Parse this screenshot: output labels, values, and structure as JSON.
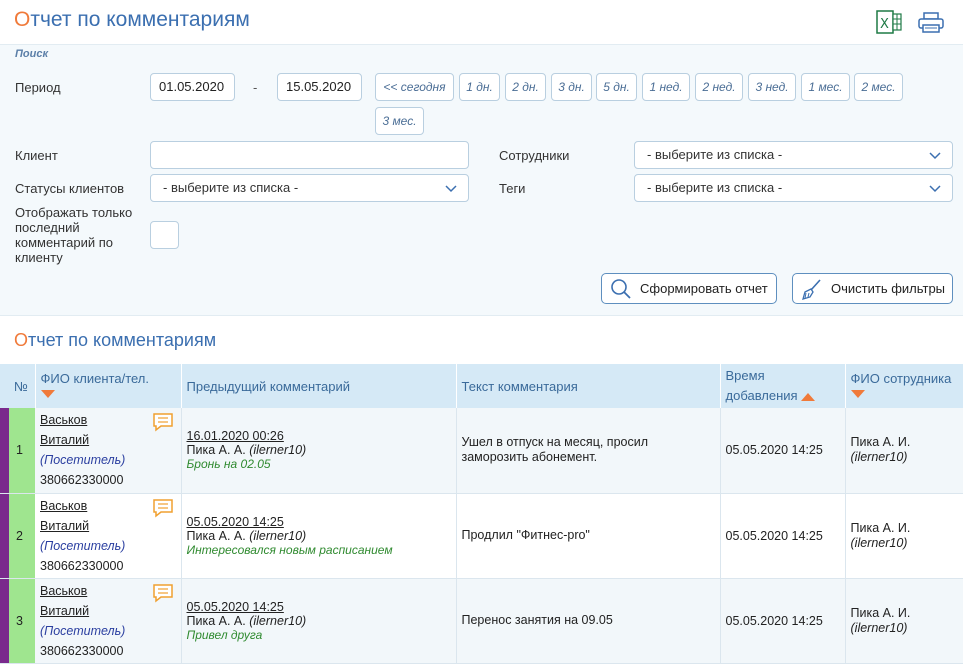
{
  "header": {
    "title_first_letter": "О",
    "title_rest": "тчет по комментариям",
    "excel_icon": "excel-icon",
    "print_icon": "printer-icon"
  },
  "filters": {
    "search_label": "Поиск",
    "period_label": "Период",
    "date_from": "01.05.2020",
    "date_separator": "-",
    "date_to": "15.05.2020",
    "quick_periods": [
      "<< сегодня",
      "1 дн.",
      "2 дн.",
      "3 дн.",
      "5 дн.",
      "1 нед.",
      "2 нед.",
      "3 нед.",
      "1 мес.",
      "2 мес.",
      "3 мес."
    ],
    "client_label": "Клиент",
    "client_value": "",
    "employees_label": "Сотрудники",
    "employees_value": "- выберите из списка -",
    "client_statuses_label": "Статусы клиентов",
    "client_statuses_value": "- выберите из списка -",
    "tags_label": "Теги",
    "tags_value": "- выберите из списка -",
    "last_comment_only_label_lines": [
      "Отображать только",
      "последний",
      "комментарий по",
      "клиенту"
    ],
    "last_comment_only_checked": false,
    "generate_button": "Сформировать отчет",
    "clear_button": "Очистить фильтры"
  },
  "report": {
    "title_first_letter": "О",
    "title_rest": "тчет по комментариям",
    "columns": {
      "num": "№",
      "client": "ФИО клиента/тел.",
      "prev_comment": "Предыдущий комментарий",
      "comment_text": "Текст комментария",
      "time_added_line1": "Время",
      "time_added_line2": "добавления",
      "employee": "ФИО сотрудника"
    },
    "rows": [
      {
        "num": "1",
        "client_surname": "Васьков",
        "client_name": "Виталий",
        "client_role": "(Посетитель)",
        "client_phone": "380662330000",
        "prev_date": "16.01.2020 00:26",
        "prev_author": "Пика А. А.",
        "prev_login": "(ilerner10)",
        "prev_note": "Бронь на 02.05",
        "text": "Ушел в отпуск на месяц, просил заморозить абонемент.",
        "time": "05.05.2020 14:25",
        "employee": "Пика А. И.",
        "employee_login": "(ilerner10)"
      },
      {
        "num": "2",
        "client_surname": "Васьков",
        "client_name": "Виталий",
        "client_role": "(Посетитель)",
        "client_phone": "380662330000",
        "prev_date": "05.05.2020 14:25",
        "prev_author": "Пика А. А.",
        "prev_login": "(ilerner10)",
        "prev_note": "Интересовался новым расписанием",
        "text": "Продлил \"Фитнес-pro\"",
        "time": "05.05.2020 14:25",
        "employee": "Пика А. И.",
        "employee_login": "(ilerner10)"
      },
      {
        "num": "3",
        "client_surname": "Васьков",
        "client_name": "Виталий",
        "client_role": "(Посетитель)",
        "client_phone": "380662330000",
        "prev_date": "05.05.2020 14:25",
        "prev_author": "Пика А. А.",
        "prev_login": "(ilerner10)",
        "prev_note": "Привел друга",
        "text": "Перенос занятия на 09.05",
        "time": "05.05.2020 14:25",
        "employee": "Пика А. И.",
        "employee_login": "(ilerner10)"
      }
    ]
  },
  "colors": {
    "accent_blue": "#3b6fb0",
    "accent_orange": "#f07a3a",
    "status_green": "#9fe58f",
    "status_purple": "#7a2a8c",
    "note_green": "#2f8a2f"
  }
}
